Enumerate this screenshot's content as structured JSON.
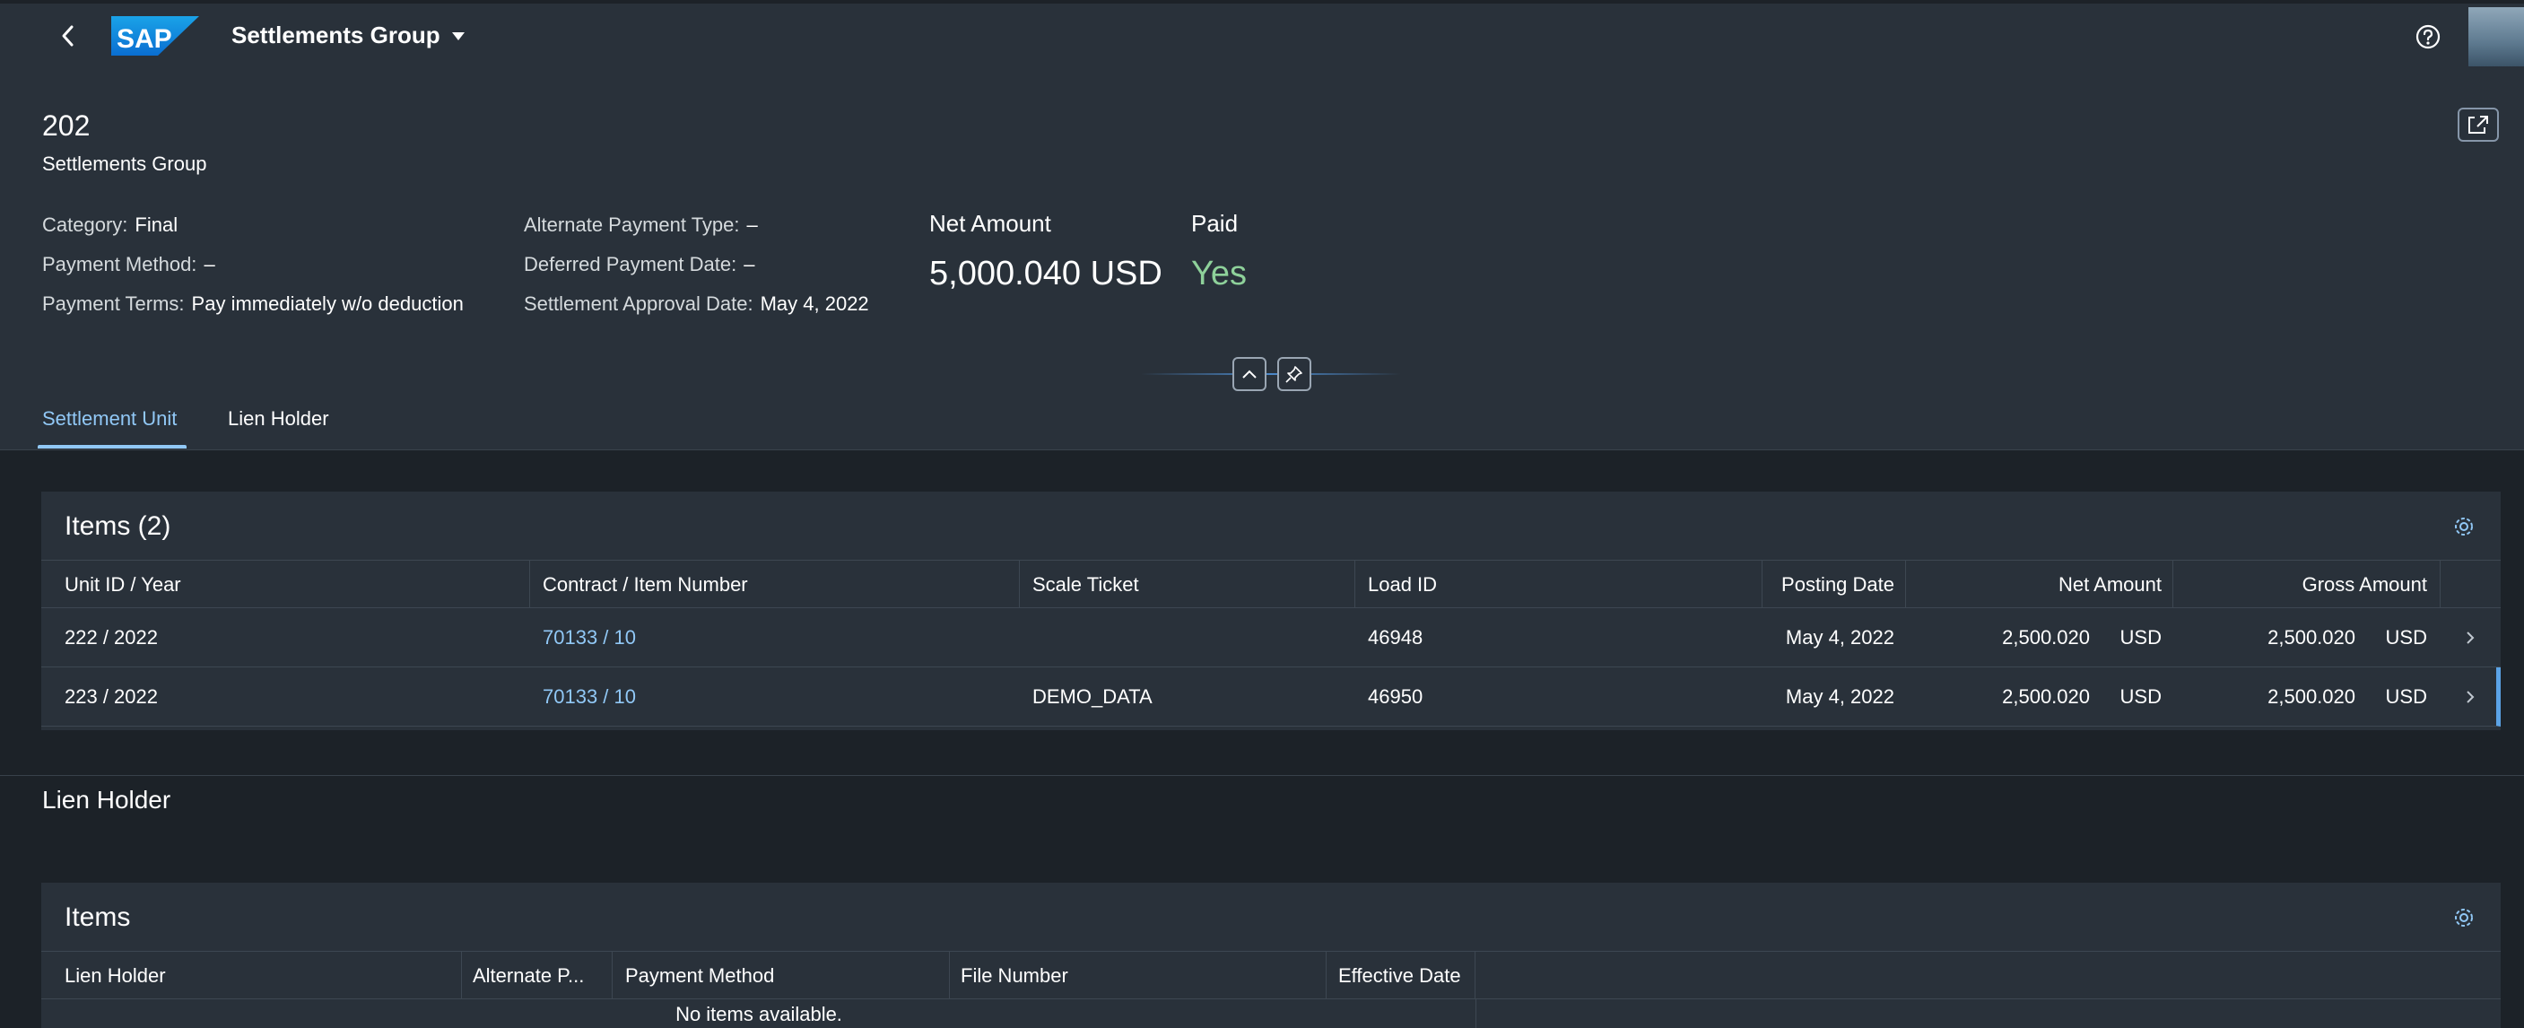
{
  "shell": {
    "title": "Settlements Group",
    "logo_text": "SAP",
    "icons": {
      "back": "chevron-left-icon",
      "menu": "caret-down-icon",
      "help": "help-icon"
    }
  },
  "header": {
    "title": "202",
    "subtitle": "Settlements Group",
    "attributes_left": [
      {
        "label": "Category:",
        "value": "Final"
      },
      {
        "label": "Payment Method:",
        "value": "–"
      },
      {
        "label": "Payment Terms:",
        "value": "Pay immediately w/o deduction"
      }
    ],
    "attributes_mid": [
      {
        "label": "Alternate Payment Type:",
        "value": "–"
      },
      {
        "label": "Deferred Payment Date:",
        "value": "–"
      },
      {
        "label": "Settlement Approval Date:",
        "value": "May 4, 2022"
      }
    ],
    "kpis": [
      {
        "label": "Net Amount",
        "value": "5,000.040 USD"
      },
      {
        "label": "Paid",
        "value": "Yes"
      }
    ],
    "tabs": [
      "Settlement Unit",
      "Lien Holder"
    ]
  },
  "items_table": {
    "title": "Items (2)",
    "columns": [
      "Unit ID / Year",
      "Contract / Item Number",
      "Scale Ticket",
      "Load ID",
      "Posting Date",
      "Net Amount",
      "Gross Amount"
    ],
    "rows": [
      {
        "unit": "222 / 2022",
        "contract": "70133 / 10",
        "ticket": "",
        "load": "46948",
        "posting": "May 4, 2022",
        "net": "2,500.020",
        "net_cur": "USD",
        "gross": "2,500.020",
        "gross_cur": "USD"
      },
      {
        "unit": "223 / 2022",
        "contract": "70133 / 10",
        "ticket": "DEMO_DATA",
        "load": "46950",
        "posting": "May 4, 2022",
        "net": "2,500.020",
        "net_cur": "USD",
        "gross": "2,500.020",
        "gross_cur": "USD"
      }
    ]
  },
  "lien_section": {
    "title": "Lien Holder",
    "table_title": "Items",
    "columns": [
      "Lien Holder",
      "Alternate P...",
      "Payment Method",
      "File Number",
      "Effective Date"
    ],
    "empty_text": "No items available."
  },
  "colors": {
    "shell_bg": "#29313a",
    "page_bg": "#1c2228",
    "link": "#91c8f6",
    "positive": "#8ed19a",
    "selection": "#5ba3e6"
  }
}
